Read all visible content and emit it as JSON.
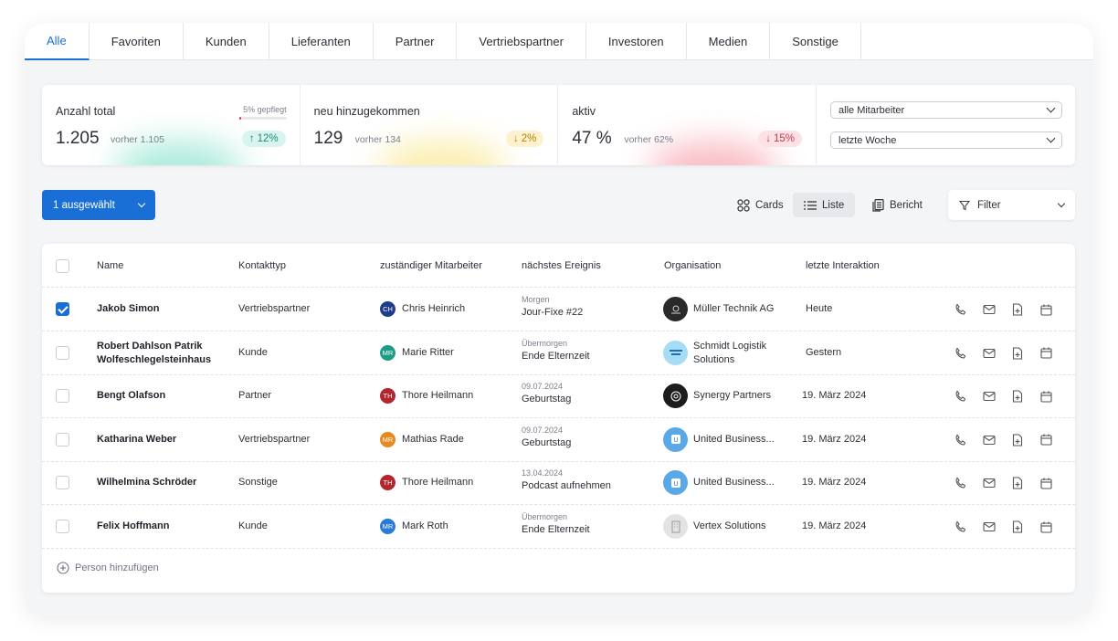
{
  "tabs": [
    "Alle",
    "Favoriten",
    "Kunden",
    "Lieferanten",
    "Partner",
    "Vertriebspartner",
    "Investoren",
    "Medien",
    "Sonstige"
  ],
  "stats": {
    "total": {
      "label": "Anzahl total",
      "value": "1.205",
      "prev": "vorher 1.105",
      "change": "12%",
      "maintained_label": "5% gepflegt",
      "maintained_fraction": 0.05
    },
    "new": {
      "label": "neu hinzugekommen",
      "value": "129",
      "prev": "vorher 134",
      "change": "2%"
    },
    "active": {
      "label": "aktiv",
      "value": "47 %",
      "prev": "vorher 62%",
      "change": "15%"
    }
  },
  "filters": {
    "employee": "alle Mitarbeiter",
    "period": "letzte Woche"
  },
  "toolbar": {
    "selected": "1 ausgewählt",
    "cards": "Cards",
    "list": "Liste",
    "report": "Bericht",
    "filter": "Filter"
  },
  "table": {
    "headers": {
      "name": "Name",
      "type": "Kontakttyp",
      "employee": "zuständiger Mitarbeiter",
      "event": "nächstes Ereignis",
      "org": "Organisation",
      "last": "letzte Interaktion"
    },
    "rows": [
      {
        "name1": "Jakob Simon",
        "name2": "",
        "type": "Vertriebspartner",
        "initials": "CH",
        "employee": "Chris Heinrich",
        "avatar_color": "#1f3c8a",
        "event_date": "Morgen",
        "event": "Jour-Fixe #22",
        "org1": "Müller Technik AG",
        "org2": "",
        "org_color": "#2a2a2a",
        "org_icon": "logo-mueller",
        "last": "Heute",
        "checked": true
      },
      {
        "name1": "Robert Dahlson Patrik",
        "name2": "Wolfeschlegelsteinhaus",
        "type": "Kunde",
        "initials": "MR",
        "employee": "Marie Ritter",
        "avatar_color": "#1f9c87",
        "event_date": "Übermorgen",
        "event": "Ende Elternzeit",
        "org1": "Schmidt Logistik",
        "org2": "Solutions",
        "org_color": "#a7dcf5",
        "org_icon": "logo-schmidt",
        "last": "Gestern",
        "checked": false
      },
      {
        "name1": "Bengt Olafson",
        "name2": "",
        "type": "Partner",
        "initials": "TH",
        "employee": "Thore Heilmann",
        "avatar_color": "#b3262f",
        "event_date": "09.07.2024",
        "event": "Geburtstag",
        "org1": "Synergy Partners",
        "org2": "",
        "org_color": "#1c1c1c",
        "org_icon": "logo-synergy",
        "last": "19. März 2024",
        "checked": false
      },
      {
        "name1": "Katharina Weber",
        "name2": "",
        "type": "Vertriebspartner",
        "initials": "MR",
        "employee": "Mathias Rade",
        "avatar_color": "#e58a1f",
        "event_date": "09.07.2024",
        "event": "Geburtstag",
        "org1": "United Business...",
        "org2": "",
        "org_color": "#5aa9e6",
        "org_icon": "logo-united",
        "last": "19. März 2024",
        "checked": false
      },
      {
        "name1": "Wilhelmina Schröder",
        "name2": "",
        "type": "Sonstige",
        "initials": "TH",
        "employee": "Thore Heilmann",
        "avatar_color": "#b3262f",
        "event_date": "13.04.2024",
        "event": "Podcast aufnehmen",
        "org1": "United Business...",
        "org2": "",
        "org_color": "#5aa9e6",
        "org_icon": "logo-united",
        "last": "19. März 2024",
        "checked": false
      },
      {
        "name1": "Felix Hoffmann",
        "name2": "",
        "type": "Kunde",
        "initials": "MR",
        "employee": "Mark Roth",
        "avatar_color": "#2a7bd6",
        "event_date": "Übermorgen",
        "event": "Ende Elternzeit",
        "org1": "Vertex Solutions",
        "org2": "",
        "org_color": "#e3e3e3",
        "org_icon": "building-icon",
        "last": "19. März 2024",
        "checked": false
      }
    ],
    "add_person": "Person hinzufügen"
  },
  "colors": {
    "accent": "#1a6fd6",
    "up": "#1d8c73",
    "warn": "#b58300",
    "danger": "#c43a4a"
  }
}
